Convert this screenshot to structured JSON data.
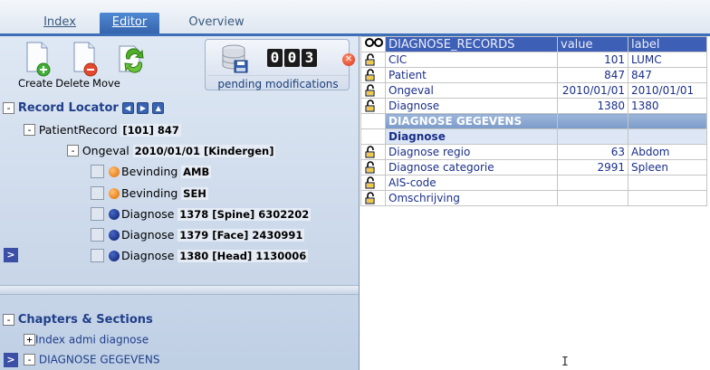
{
  "tabs": [
    {
      "label": "Index",
      "active": false
    },
    {
      "label": "Editor",
      "active": true
    },
    {
      "label": "Overview",
      "active": false
    }
  ],
  "toolbar": {
    "create_label": "Create",
    "delete_label": "Delete",
    "move_label": "Move"
  },
  "pending": {
    "digits": [
      "0",
      "0",
      "3"
    ],
    "label": "pending modifications"
  },
  "record_locator": {
    "title": "Record Locator",
    "patient": {
      "label": "PatientRecord",
      "value": "[101] 847"
    },
    "ongeval": {
      "label": "Ongeval",
      "value": "2010/01/01 [Kindergen]"
    },
    "items": [
      {
        "label": "Bevinding",
        "value": "AMB",
        "color": "orange"
      },
      {
        "label": "Bevinding",
        "value": "SEH",
        "color": "orange"
      },
      {
        "label": "Diagnose",
        "value": "1378 [Spine] 6302202",
        "color": "blue"
      },
      {
        "label": "Diagnose",
        "value": "1379 [Face] 2430991",
        "color": "blue"
      },
      {
        "label": "Diagnose",
        "value": "1380 [Head] 1130006",
        "color": "blue"
      }
    ]
  },
  "chapters": {
    "title": "Chapters & Sections",
    "items": [
      {
        "label": "Index admi diagnose"
      },
      {
        "label": "DIAGNOSE GEGEVENS"
      }
    ]
  },
  "grid": {
    "headers": {
      "name": "DIAGNOSE_RECORDS",
      "value": "value",
      "label": "label"
    },
    "rows": [
      {
        "kind": "field",
        "name": "CIC",
        "value": "101",
        "label": "LUMC"
      },
      {
        "kind": "field",
        "name": "Patient",
        "value": "847",
        "label": "847"
      },
      {
        "kind": "field",
        "name": "Ongeval",
        "value": "2010/01/01",
        "label": "2010/01/01"
      },
      {
        "kind": "field",
        "name": "Diagnose",
        "value": "1380",
        "label": "1380"
      },
      {
        "kind": "section",
        "name": "DIAGNOSE GEGEVENS",
        "value": "",
        "label": ""
      },
      {
        "kind": "sub",
        "name": "Diagnose",
        "value": "",
        "label": ""
      },
      {
        "kind": "field",
        "name": "Diagnose regio",
        "value": "63",
        "label": "Abdom"
      },
      {
        "kind": "field",
        "name": "Diagnose categorie",
        "value": "2991",
        "label": "Spleen"
      },
      {
        "kind": "field",
        "name": "AIS-code",
        "value": "",
        "label": ""
      },
      {
        "kind": "field",
        "name": "Omschrijving",
        "value": "",
        "label": ""
      }
    ]
  },
  "colors": {
    "accent": "#3e5fb6",
    "tab_active": "#3565ad",
    "panel_bg": "#d4deec",
    "link": "#1f3f8a"
  }
}
